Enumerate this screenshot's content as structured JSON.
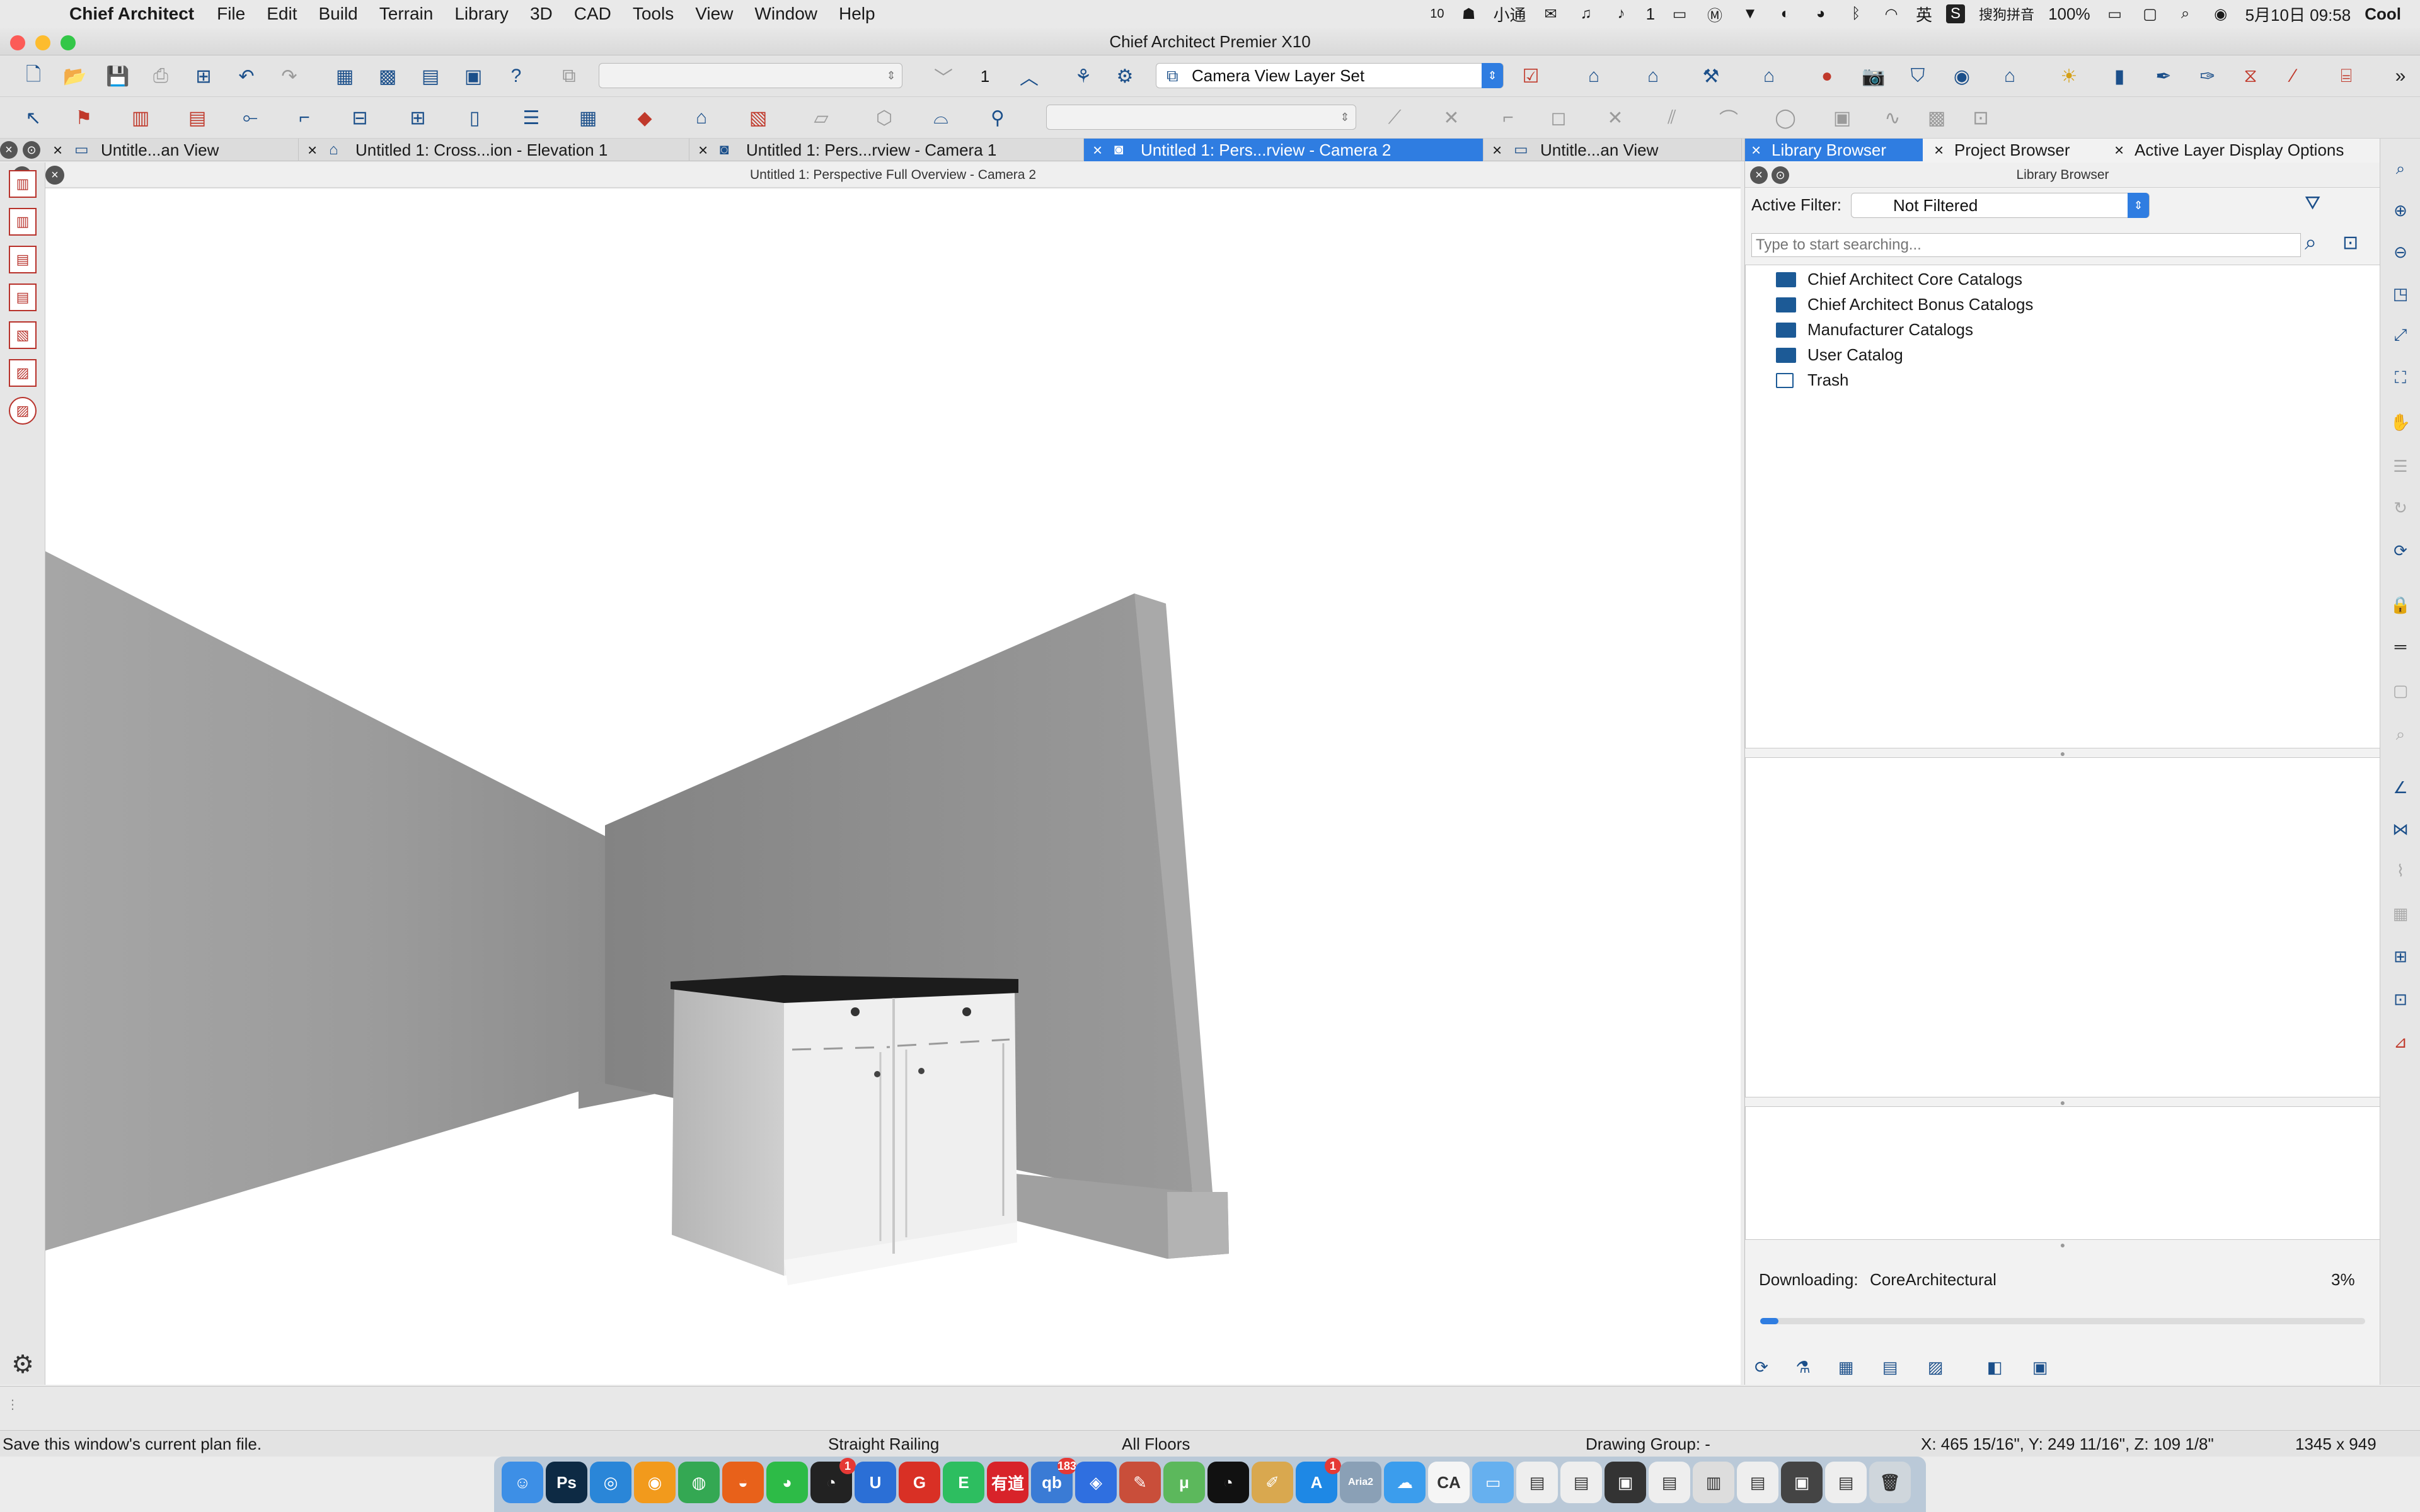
{
  "menubar": {
    "app_name": "Chief Architect",
    "menus": [
      "File",
      "Edit",
      "Build",
      "Terrain",
      "Library",
      "3D",
      "CAD",
      "Tools",
      "View",
      "Window",
      "Help"
    ],
    "tray": {
      "num": "10",
      "app_label": "小通",
      "notif_count": "1",
      "lang": "英",
      "ime": "搜狗拼音",
      "battery": "100%",
      "datetime": "5月10日  09:58",
      "user": "Cool"
    }
  },
  "window": {
    "title": "Chief Architect Premier X10"
  },
  "toolbar1": {
    "floor_value": "1",
    "layer_set": "Camera View Layer Set"
  },
  "tabs": [
    {
      "label": "Untitle...an View",
      "active": false
    },
    {
      "label": "Untitled 1: Cross...ion - Elevation 1",
      "active": false
    },
    {
      "label": "Untitled 1: Pers...rview - Camera 1",
      "active": false
    },
    {
      "label": "Untitled 1: Pers...rview - Camera 2",
      "active": true
    },
    {
      "label": "Untitle...an View",
      "active": false
    }
  ],
  "view": {
    "header": "Untitled 1: Perspective Full Overview - Camera 2"
  },
  "panel": {
    "tabs": [
      "Library Browser",
      "Project Browser",
      "Active Layer Display Options"
    ],
    "header": "Library Browser",
    "filter_label": "Active Filter:",
    "filter_value": "Not Filtered",
    "search_placeholder": "Type to start searching...",
    "tree": [
      {
        "label": "Chief Architect Core Catalogs"
      },
      {
        "label": "Chief Architect Bonus Catalogs"
      },
      {
        "label": "Manufacturer Catalogs"
      },
      {
        "label": "User Catalog"
      },
      {
        "label": "Trash"
      }
    ],
    "download": {
      "label": "Downloading:",
      "item": "CoreArchitectural",
      "percent_text": "3%",
      "progress": 0.03
    }
  },
  "status": {
    "hint": "Save this window's current plan file.",
    "tool": "Straight Railing",
    "floors": "All Floors",
    "group": "Drawing Group: -",
    "coords": "X: 465 15/16\", Y: 249 11/16\", Z: 109 1/8\"",
    "size": "1345 x 949"
  },
  "dock": {
    "apps": [
      {
        "name": "finder",
        "glyph": "☺",
        "color": "#3d8fe6"
      },
      {
        "name": "photoshop",
        "glyph": "Ps",
        "color": "#0d2a44"
      },
      {
        "name": "safari",
        "glyph": "◎",
        "color": "#2a86d8"
      },
      {
        "name": "fruit",
        "glyph": "◉",
        "color": "#f29a1c"
      },
      {
        "name": "chrome",
        "glyph": "◍",
        "color": "#34a853"
      },
      {
        "name": "firefox",
        "glyph": "◒",
        "color": "#e8611a"
      },
      {
        "name": "wechat",
        "glyph": "◕",
        "color": "#2dbb47"
      },
      {
        "name": "qq",
        "glyph": "◔",
        "color": "#222222",
        "badge": "1"
      },
      {
        "name": "u-app",
        "glyph": "U",
        "color": "#2b6fd6"
      },
      {
        "name": "g-app",
        "glyph": "G",
        "color": "#d93025"
      },
      {
        "name": "evernote",
        "glyph": "E",
        "color": "#2dbe60"
      },
      {
        "name": "youdao",
        "glyph": "有道",
        "color": "#d8232a"
      },
      {
        "name": "qb",
        "glyph": "qb",
        "color": "#3a7bd5",
        "badge": "183"
      },
      {
        "name": "baidu",
        "glyph": "◈",
        "color": "#2f6fe0"
      },
      {
        "name": "paint",
        "glyph": "✎",
        "color": "#c94e3a"
      },
      {
        "name": "utorrent",
        "glyph": "μ",
        "color": "#5cb85c"
      },
      {
        "name": "qq2",
        "glyph": "◔",
        "color": "#111111"
      },
      {
        "name": "pencil",
        "glyph": "✐",
        "color": "#d9a84f"
      },
      {
        "name": "appstore",
        "glyph": "A",
        "color": "#1e88e5",
        "badge": "1"
      },
      {
        "name": "aria2",
        "glyph": "Aria2",
        "color": "#8aa0b6"
      },
      {
        "name": "icloud",
        "glyph": "☁",
        "color": "#3b9ded"
      },
      {
        "name": "chief-architect",
        "glyph": "CA",
        "color": "#f5f5f5"
      },
      {
        "name": "folder",
        "glyph": "▭",
        "color": "#66b0ef"
      },
      {
        "name": "doc1",
        "glyph": "▤",
        "color": "#eeeeee"
      },
      {
        "name": "doc2",
        "glyph": "▤",
        "color": "#eeeeee"
      },
      {
        "name": "terminal",
        "glyph": "▣",
        "color": "#333333"
      },
      {
        "name": "doc3",
        "glyph": "▤",
        "color": "#eeeeee"
      },
      {
        "name": "doc4",
        "glyph": "▥",
        "color": "#dddddd"
      },
      {
        "name": "doc5",
        "glyph": "▤",
        "color": "#eeeeee"
      },
      {
        "name": "screen",
        "glyph": "▣",
        "color": "#444444"
      },
      {
        "name": "doc6",
        "glyph": "▤",
        "color": "#eeeeee"
      },
      {
        "name": "trash",
        "glyph": "🗑",
        "color": "#cfd6dc"
      }
    ]
  },
  "colors": {
    "accent": "#2f7de1",
    "concrete": "#9a9a9a",
    "cabinet": "#f1f1f1",
    "countertop": "#1c1c1c"
  }
}
